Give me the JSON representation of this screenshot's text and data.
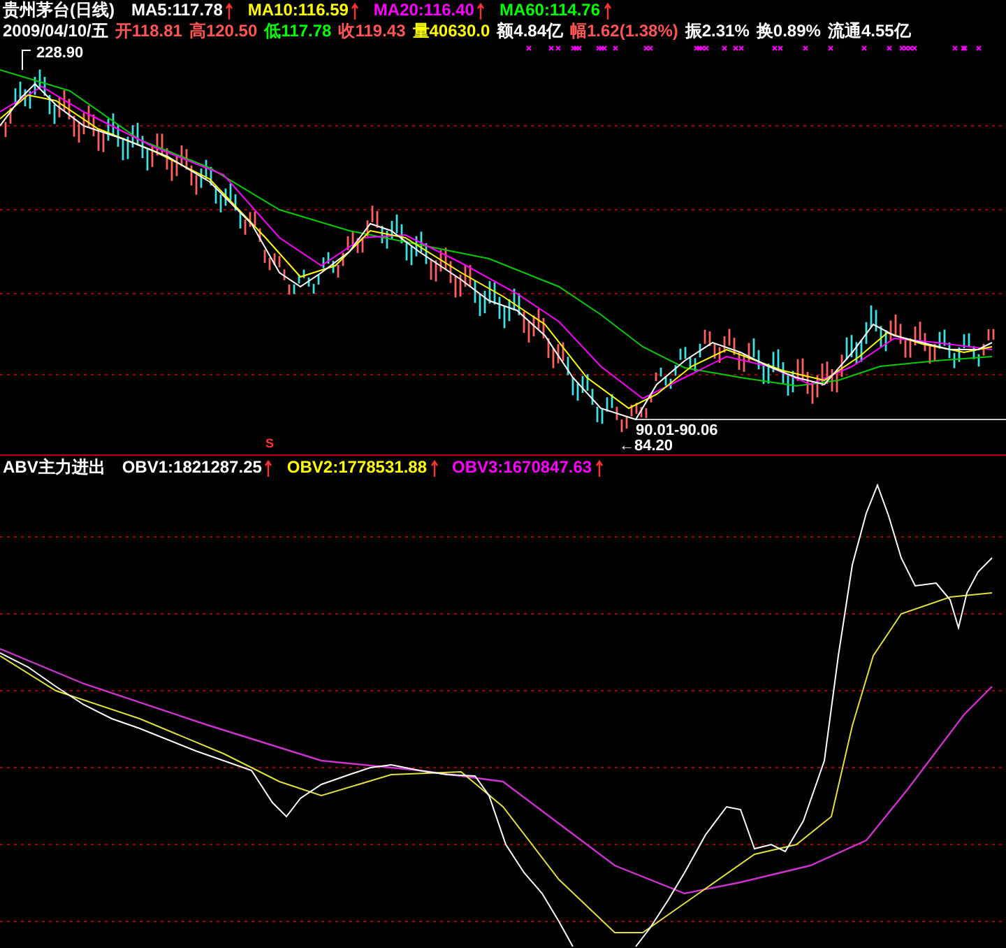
{
  "header": {
    "title": "贵州茅台(日线)",
    "ma": [
      {
        "label": "MA5:117.78",
        "color": "#ffffff"
      },
      {
        "label": "MA10:116.59",
        "color": "#ffff00"
      },
      {
        "label": "MA20:116.40",
        "color": "#ff00ff"
      },
      {
        "label": "MA60:114.76",
        "color": "#00ff00"
      }
    ]
  },
  "quote": {
    "date": "2009/04/10/五",
    "fields": [
      {
        "text": "开118.81",
        "color": "#ff5555"
      },
      {
        "text": "高120.50",
        "color": "#ff5555"
      },
      {
        "text": "低117.78",
        "color": "#00ff00"
      },
      {
        "text": "收119.43",
        "color": "#ff5555"
      },
      {
        "text": "量40630.0",
        "color": "#ffff00"
      },
      {
        "text": "额4.84亿",
        "color": "#ffffff"
      },
      {
        "text": "幅1.62(1.38%)",
        "color": "#ff5555"
      },
      {
        "text": "振2.31%",
        "color": "#ffffff"
      },
      {
        "text": "换0.89%",
        "color": "#ffffff"
      },
      {
        "text": "流通4.55亿",
        "color": "#ffffff"
      }
    ]
  },
  "price_chart": {
    "high_label": "228.90",
    "range_label": "90.01-90.06",
    "low_label": "←84.20",
    "signal": "S"
  },
  "indicator": {
    "title": "ABV主力进出",
    "lines": [
      {
        "label": "OBV1:1821287.25",
        "color": "#ffffff"
      },
      {
        "label": "OBV2:1778531.88",
        "color": "#ffff00"
      },
      {
        "label": "OBV3:1670847.63",
        "color": "#ff00ff"
      }
    ]
  }
}
